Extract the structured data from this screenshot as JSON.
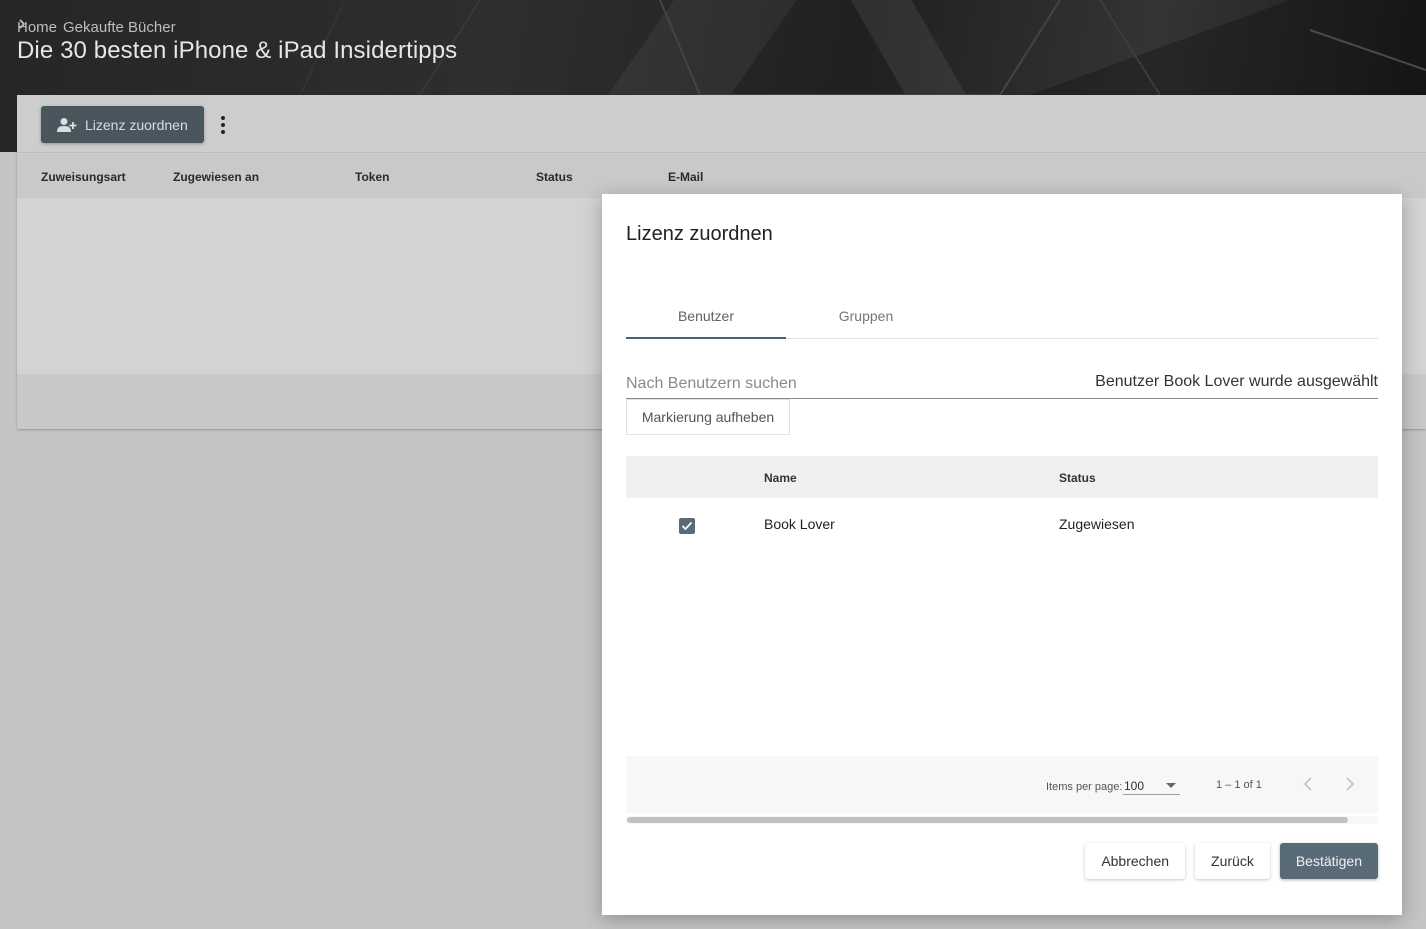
{
  "breadcrumb": {
    "home": "Home",
    "category": "Gekaufte Bücher"
  },
  "page_title": "Die 30 besten iPhone & iPad Insidertipps",
  "toolbar": {
    "assign_label": "Lizenz zuordnen"
  },
  "background_table": {
    "columns": [
      "Zuweisungsart",
      "Zugewiesen an",
      "Token",
      "Status",
      "E-Mail"
    ]
  },
  "dialog": {
    "title": "Lizenz zuordnen",
    "tabs": [
      {
        "label": "Benutzer",
        "active": true
      },
      {
        "label": "Gruppen",
        "active": false
      }
    ],
    "search": {
      "placeholder": "Nach Benutzern suchen",
      "value": ""
    },
    "selected_info": "Benutzer Book Lover wurde ausgewählt",
    "unmark_label": "Markierung aufheben",
    "users_table": {
      "columns": {
        "name": "Name",
        "status": "Status"
      },
      "rows": [
        {
          "name": "Book Lover",
          "status": "Zugewiesen",
          "checked": true
        }
      ]
    },
    "paginator": {
      "items_per_page_label": "Items per page:",
      "items_per_page_value": "100",
      "range_label": "1 – 1 of 1"
    },
    "actions": {
      "cancel_label": "Abbrechen",
      "back_label": "Zurück",
      "confirm_label": "Bestätigen"
    }
  },
  "colors": {
    "primary": "#5a6b78",
    "assign_button": "#4a565e",
    "overlay_background": "#c4c4c4"
  }
}
